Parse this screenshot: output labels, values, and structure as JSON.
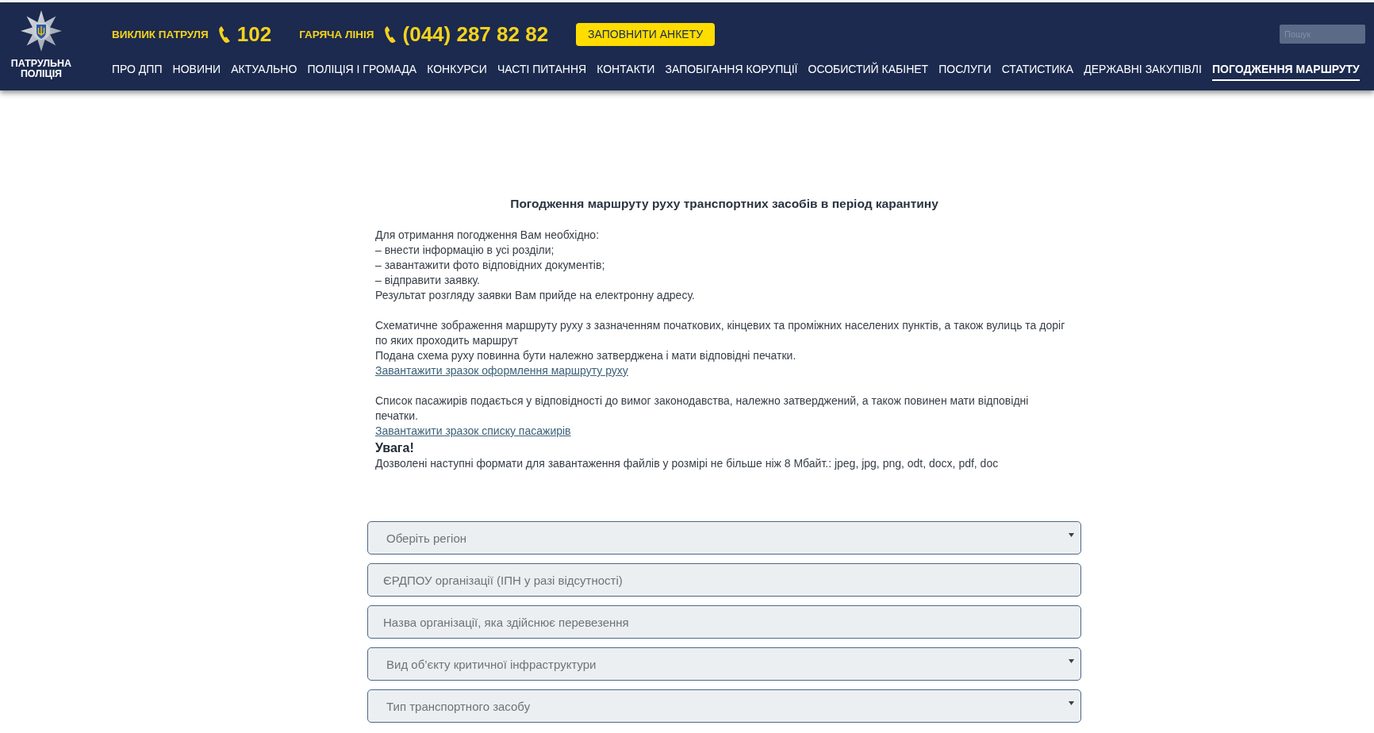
{
  "header": {
    "logo": {
      "text": "ПАТРУЛЬНА ПОЛІЦІЯ"
    },
    "hotlines": [
      {
        "label": "ВИКЛИК ПАТРУЛЯ",
        "number": "102"
      },
      {
        "label": "ГАРЯЧА ЛІНІЯ",
        "number": "(044) 287 82 82"
      }
    ],
    "cta_button": "ЗАПОВНИТИ АНКЕТУ",
    "search": {
      "placeholder": "Пошук"
    },
    "nav": [
      {
        "label": "ПРО ДПП",
        "selected": false
      },
      {
        "label": "НОВИНИ",
        "selected": false
      },
      {
        "label": "АКТУАЛЬНО",
        "selected": false
      },
      {
        "label": "ПОЛІЦІЯ І ГРОМАДА",
        "selected": false
      },
      {
        "label": "КОНКУРСИ",
        "selected": false
      },
      {
        "label": "ЧАСТІ ПИТАННЯ",
        "selected": false
      },
      {
        "label": "КОНТАКТИ",
        "selected": false
      },
      {
        "label": "ЗАПОБІГАННЯ КОРУПЦІЇ",
        "selected": false
      },
      {
        "label": "ОСОБИСТИЙ КАБІНЕТ",
        "selected": false
      },
      {
        "label": "ПОСЛУГИ",
        "selected": false
      },
      {
        "label": "СТАТИСТИКА",
        "selected": false
      },
      {
        "label": "ДЕРЖАВНІ ЗАКУПІВЛІ",
        "selected": false
      },
      {
        "label": "ПОГОДЖЕННЯ МАРШРУТУ",
        "selected": true
      }
    ]
  },
  "page": {
    "title": "Погодження маршруту руху транспортних засобів в період карантину",
    "sections": [
      {
        "items": [
          {
            "kind": "text",
            "text": "Для отримання погодження Вам необхідно:"
          },
          {
            "kind": "text",
            "text": "– внести інформацію в усі розділи;"
          },
          {
            "kind": "text",
            "text": "– завантажити фото відповідних документів;"
          },
          {
            "kind": "text",
            "text": "– відправити заявку."
          },
          {
            "kind": "text",
            "text": "Результат розгляду заявки Вам прийде на електронну адресу."
          }
        ]
      },
      {
        "items": [
          {
            "kind": "text",
            "text": "Схематичне зображення маршруту руху з зазначенням початкових, кінцевих та проміжних населених пунктів, а також вулиць та доріг по яких проходить маршрут"
          },
          {
            "kind": "text",
            "text": "Подана схема руху повинна бути належно затверджена і мати відповідні печатки."
          },
          {
            "kind": "link",
            "text": "Завантажити зразок оформлення маршруту руху"
          }
        ]
      },
      {
        "items": [
          {
            "kind": "text",
            "text": "Список пасажирів подається у відповідності до вимог законодавства, належно затверджений, а також повинен мати відповідні печатки."
          },
          {
            "kind": "link",
            "text": "Завантажити зразок списку пасажирів"
          },
          {
            "kind": "heading",
            "text": "Увага!"
          },
          {
            "kind": "text",
            "text": "Дозволені наступні формати для завантаження файлів у розмірі не більше ніж 8 Мбайт.: jpeg, jpg, png, odt, docx, pdf, doc"
          }
        ]
      }
    ]
  },
  "form": {
    "fields": [
      {
        "kind": "select",
        "placeholder": "Оберіть регіон"
      },
      {
        "kind": "input",
        "placeholder": "ЄРДПОУ організації (ІПН у разі відсутності)"
      },
      {
        "kind": "input",
        "placeholder": "Назва організації, яка здійснює перевезення"
      },
      {
        "kind": "select",
        "placeholder": "Вид об’єкту критичної інфраструктури"
      },
      {
        "kind": "select",
        "placeholder": "Тип транспортного засобу"
      }
    ]
  }
}
